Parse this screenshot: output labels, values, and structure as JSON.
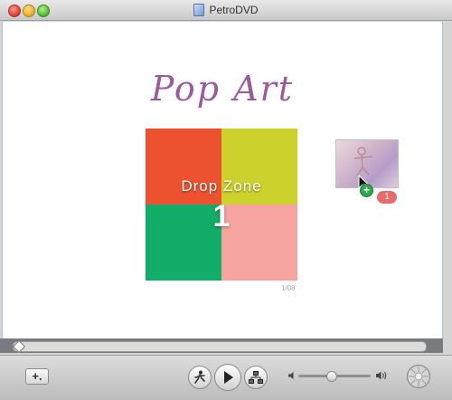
{
  "window": {
    "title": "PetroDVD",
    "icon": "document-icon"
  },
  "canvas": {
    "menu_title": "Pop Art",
    "drop_zone": {
      "label": "Drop Zone",
      "number": "1",
      "quadrant_colors": [
        "#ed5230",
        "#cdd12c",
        "#12ad68",
        "#f6a4a0"
      ]
    },
    "counter_text": "1/08",
    "drag": {
      "badge_count": "1",
      "add_glyph": "+"
    }
  },
  "toolbar": {
    "add_button_label": "+.",
    "icons": [
      "motion-icon",
      "play-icon",
      "menu-map-icon",
      "volume-low-icon",
      "volume-high-icon",
      "burn-icon"
    ],
    "volume_level": 0.45
  },
  "colors": {
    "title": "#9b5a9e",
    "accent_green": "#2fa84a",
    "badge": "#e96a6a"
  }
}
